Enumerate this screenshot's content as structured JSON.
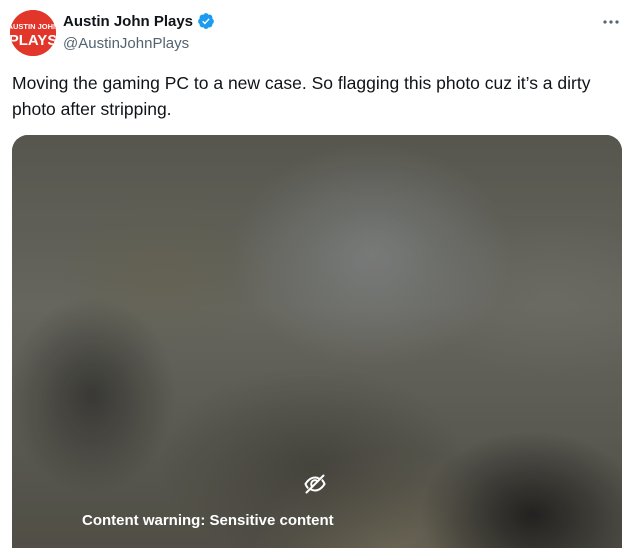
{
  "author": {
    "display_name": "Austin John Plays",
    "handle": "@AustinJohnPlays",
    "verified": true,
    "avatar_text": "AUSTIN JOHN PLAYS"
  },
  "tweet": {
    "text": "Moving the gaming PC to a new case. So flagging this photo cuz it’s a dirty photo after stripping."
  },
  "media": {
    "warning": "Content warning: Sensitive content",
    "icon": "eye-off-icon"
  },
  "icons": {
    "verified": "verified-badge-icon",
    "more": "more-horizontal-icon"
  },
  "colors": {
    "verified_blue": "#1d9bf0",
    "avatar_red": "#e2362a",
    "secondary_text": "#536471"
  }
}
